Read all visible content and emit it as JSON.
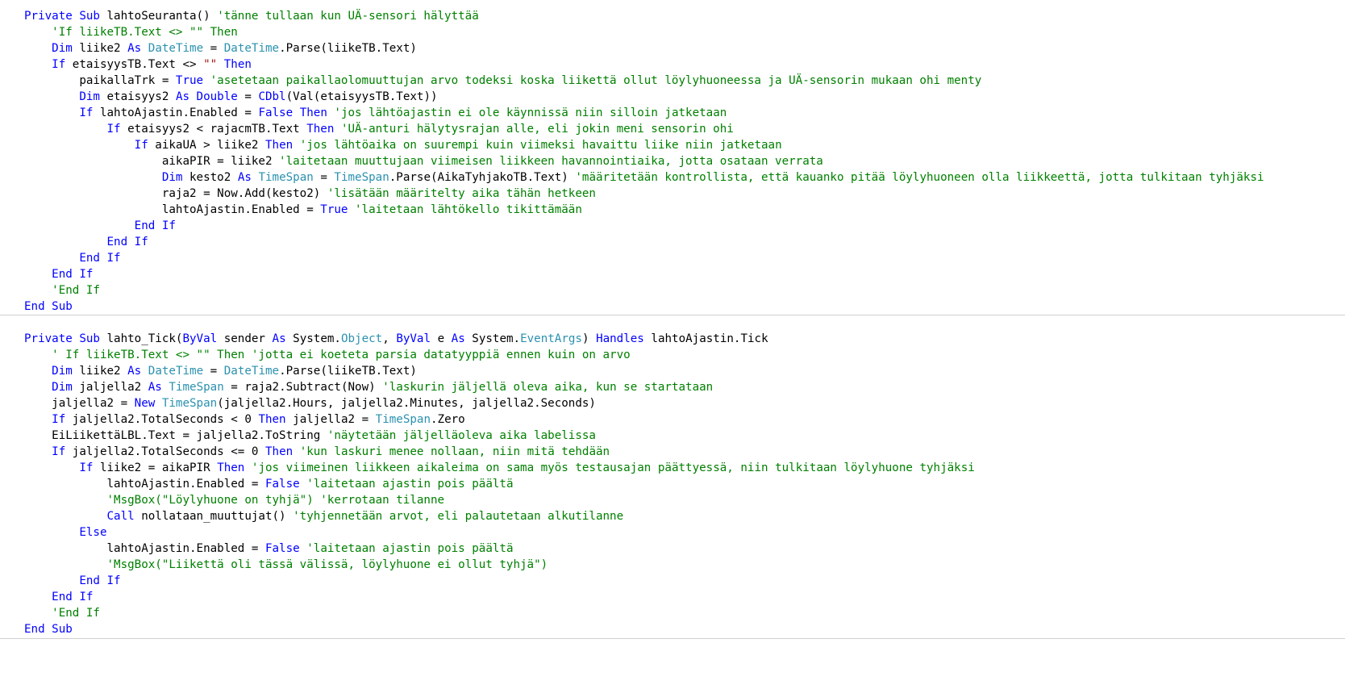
{
  "editor": {
    "language": "Visual Basic",
    "colors": {
      "keyword": "#0000ff",
      "type": "#2b91af",
      "comment": "#008000",
      "string": "#a31515",
      "plain": "#000000",
      "separator": "#d0d0d0"
    },
    "blocks": [
      {
        "lines": [
          [
            [
              "kw",
              "Private Sub"
            ],
            [
              "pl",
              " lahtoSeuranta() "
            ],
            [
              "cm",
              "'tänne tullaan kun UÄ-sensori hälyttää"
            ]
          ],
          [
            [
              "pl",
              "    "
            ],
            [
              "cm",
              "'If liikeTB.Text <> \"\" Then"
            ]
          ],
          [
            [
              "pl",
              "    "
            ],
            [
              "kw",
              "Dim"
            ],
            [
              "pl",
              " liike2 "
            ],
            [
              "kw",
              "As"
            ],
            [
              "pl",
              " "
            ],
            [
              "type",
              "DateTime"
            ],
            [
              "pl",
              " = "
            ],
            [
              "type",
              "DateTime"
            ],
            [
              "pl",
              ".Parse(liikeTB.Text)"
            ]
          ],
          [
            [
              "pl",
              "    "
            ],
            [
              "kw",
              "If"
            ],
            [
              "pl",
              " etaisyysTB.Text <> "
            ],
            [
              "str",
              "\"\""
            ],
            [
              "pl",
              " "
            ],
            [
              "kw",
              "Then"
            ]
          ],
          [
            [
              "pl",
              "        paikallaTrk = "
            ],
            [
              "kw",
              "True"
            ],
            [
              "pl",
              " "
            ],
            [
              "cm",
              "'asetetaan paikallaolomuuttujan arvo todeksi koska liikettä ollut löylyhuoneessa ja UÄ-sensorin mukaan ohi menty"
            ]
          ],
          [
            [
              "pl",
              "        "
            ],
            [
              "kw",
              "Dim"
            ],
            [
              "pl",
              " etaisyys2 "
            ],
            [
              "kw",
              "As Double"
            ],
            [
              "pl",
              " = "
            ],
            [
              "kw",
              "CDbl"
            ],
            [
              "pl",
              "(Val(etaisyysTB.Text))"
            ]
          ],
          [
            [
              "pl",
              "        "
            ],
            [
              "kw",
              "If"
            ],
            [
              "pl",
              " lahtoAjastin.Enabled = "
            ],
            [
              "kw",
              "False"
            ],
            [
              "pl",
              " "
            ],
            [
              "kw",
              "Then"
            ],
            [
              "pl",
              " "
            ],
            [
              "cm",
              "'jos lähtöajastin ei ole käynnissä niin silloin jatketaan"
            ]
          ],
          [
            [
              "pl",
              "            "
            ],
            [
              "kw",
              "If"
            ],
            [
              "pl",
              " etaisyys2 < rajacmTB.Text "
            ],
            [
              "kw",
              "Then"
            ],
            [
              "pl",
              " "
            ],
            [
              "cm",
              "'UÄ-anturi hälytysrajan alle, eli jokin meni sensorin ohi"
            ]
          ],
          [
            [
              "pl",
              "                "
            ],
            [
              "kw",
              "If"
            ],
            [
              "pl",
              " aikaUA > liike2 "
            ],
            [
              "kw",
              "Then"
            ],
            [
              "pl",
              " "
            ],
            [
              "cm",
              "'jos lähtöaika on suurempi kuin viimeksi havaittu liike niin jatketaan"
            ]
          ],
          [
            [
              "pl",
              "                    aikaPIR = liike2 "
            ],
            [
              "cm",
              "'laitetaan muuttujaan viimeisen liikkeen havannointiaika, jotta osataan verrata"
            ]
          ],
          [
            [
              "pl",
              "                    "
            ],
            [
              "kw",
              "Dim"
            ],
            [
              "pl",
              " kesto2 "
            ],
            [
              "kw",
              "As"
            ],
            [
              "pl",
              " "
            ],
            [
              "type",
              "TimeSpan"
            ],
            [
              "pl",
              " = "
            ],
            [
              "type",
              "TimeSpan"
            ],
            [
              "pl",
              ".Parse(AikaTyhjakoTB.Text) "
            ],
            [
              "cm",
              "'määritetään kontrollista, että kauanko pitää löylyhuoneen olla liikkeettä, jotta tulkitaan tyhjäksi"
            ]
          ],
          [
            [
              "pl",
              "                    raja2 = Now.Add(kesto2) "
            ],
            [
              "cm",
              "'lisätään määritelty aika tähän hetkeen"
            ]
          ],
          [
            [
              "pl",
              "                    lahtoAjastin.Enabled = "
            ],
            [
              "kw",
              "True"
            ],
            [
              "pl",
              " "
            ],
            [
              "cm",
              "'laitetaan lähtökello tikittämään"
            ]
          ],
          [
            [
              "pl",
              "                "
            ],
            [
              "kw",
              "End If"
            ]
          ],
          [
            [
              "pl",
              "            "
            ],
            [
              "kw",
              "End If"
            ]
          ],
          [
            [
              "pl",
              "        "
            ],
            [
              "kw",
              "End If"
            ]
          ],
          [
            [
              "pl",
              "    "
            ],
            [
              "kw",
              "End If"
            ]
          ],
          [
            [
              "pl",
              "    "
            ],
            [
              "cm",
              "'End If"
            ]
          ],
          [
            [
              "kw",
              "End Sub"
            ]
          ]
        ]
      },
      {
        "lines": [
          [
            [
              "kw",
              "Private Sub"
            ],
            [
              "pl",
              " lahto_Tick("
            ],
            [
              "kw",
              "ByVal"
            ],
            [
              "pl",
              " sender "
            ],
            [
              "kw",
              "As"
            ],
            [
              "pl",
              " System."
            ],
            [
              "type",
              "Object"
            ],
            [
              "pl",
              ", "
            ],
            [
              "kw",
              "ByVal"
            ],
            [
              "pl",
              " e "
            ],
            [
              "kw",
              "As"
            ],
            [
              "pl",
              " System."
            ],
            [
              "type",
              "EventArgs"
            ],
            [
              "pl",
              ") "
            ],
            [
              "kw",
              "Handles"
            ],
            [
              "pl",
              " lahtoAjastin.Tick"
            ]
          ],
          [
            [
              "pl",
              "    "
            ],
            [
              "cm",
              "' If liikeTB.Text <> \"\" Then 'jotta ei koeteta parsia datatyyppiä ennen kuin on arvo"
            ]
          ],
          [
            [
              "pl",
              "    "
            ],
            [
              "kw",
              "Dim"
            ],
            [
              "pl",
              " liike2 "
            ],
            [
              "kw",
              "As"
            ],
            [
              "pl",
              " "
            ],
            [
              "type",
              "DateTime"
            ],
            [
              "pl",
              " = "
            ],
            [
              "type",
              "DateTime"
            ],
            [
              "pl",
              ".Parse(liikeTB.Text)"
            ]
          ],
          [
            [
              "pl",
              "    "
            ],
            [
              "kw",
              "Dim"
            ],
            [
              "pl",
              " jaljella2 "
            ],
            [
              "kw",
              "As"
            ],
            [
              "pl",
              " "
            ],
            [
              "type",
              "TimeSpan"
            ],
            [
              "pl",
              " = raja2.Subtract(Now) "
            ],
            [
              "cm",
              "'laskurin jäljellä oleva aika, kun se startataan"
            ]
          ],
          [
            [
              "pl",
              "    jaljella2 = "
            ],
            [
              "kw",
              "New"
            ],
            [
              "pl",
              " "
            ],
            [
              "type",
              "TimeSpan"
            ],
            [
              "pl",
              "(jaljella2.Hours, jaljella2.Minutes, jaljella2.Seconds)"
            ]
          ],
          [
            [
              "pl",
              "    "
            ],
            [
              "kw",
              "If"
            ],
            [
              "pl",
              " jaljella2.TotalSeconds < 0 "
            ],
            [
              "kw",
              "Then"
            ],
            [
              "pl",
              " jaljella2 = "
            ],
            [
              "type",
              "TimeSpan"
            ],
            [
              "pl",
              ".Zero"
            ]
          ],
          [
            [
              "pl",
              "    EiLiikettäLBL.Text = jaljella2.ToString "
            ],
            [
              "cm",
              "'näytetään jäljelläoleva aika labelissa"
            ]
          ],
          [
            [
              "pl",
              "    "
            ],
            [
              "kw",
              "If"
            ],
            [
              "pl",
              " jaljella2.TotalSeconds <= 0 "
            ],
            [
              "kw",
              "Then"
            ],
            [
              "pl",
              " "
            ],
            [
              "cm",
              "'kun laskuri menee nollaan, niin mitä tehdään"
            ]
          ],
          [
            [
              "pl",
              "        "
            ],
            [
              "kw",
              "If"
            ],
            [
              "pl",
              " liike2 = aikaPIR "
            ],
            [
              "kw",
              "Then"
            ],
            [
              "pl",
              " "
            ],
            [
              "cm",
              "'jos viimeinen liikkeen aikaleima on sama myös testausajan päättyessä, niin tulkitaan löylyhuone tyhjäksi"
            ]
          ],
          [
            [
              "pl",
              "            lahtoAjastin.Enabled = "
            ],
            [
              "kw",
              "False"
            ],
            [
              "pl",
              " "
            ],
            [
              "cm",
              "'laitetaan ajastin pois päältä"
            ]
          ],
          [
            [
              "pl",
              "            "
            ],
            [
              "cm",
              "'MsgBox(\"Löylyhuone on tyhjä\") 'kerrotaan tilanne"
            ]
          ],
          [
            [
              "pl",
              "            "
            ],
            [
              "kw",
              "Call"
            ],
            [
              "pl",
              " nollataan_muuttujat() "
            ],
            [
              "cm",
              "'tyhjennetään arvot, eli palautetaan alkutilanne"
            ]
          ],
          [
            [
              "pl",
              "        "
            ],
            [
              "kw",
              "Else"
            ]
          ],
          [
            [
              "pl",
              "            lahtoAjastin.Enabled = "
            ],
            [
              "kw",
              "False"
            ],
            [
              "pl",
              " "
            ],
            [
              "cm",
              "'laitetaan ajastin pois päältä"
            ]
          ],
          [
            [
              "pl",
              "            "
            ],
            [
              "cm",
              "'MsgBox(\"Liikettä oli tässä välissä, löylyhuone ei ollut tyhjä\")"
            ]
          ],
          [
            [
              "pl",
              "        "
            ],
            [
              "kw",
              "End If"
            ]
          ],
          [
            [
              "pl",
              "    "
            ],
            [
              "kw",
              "End If"
            ]
          ],
          [
            [
              "pl",
              "    "
            ],
            [
              "cm",
              "'End If"
            ]
          ],
          [
            [
              "kw",
              "End Sub"
            ]
          ]
        ]
      }
    ]
  }
}
